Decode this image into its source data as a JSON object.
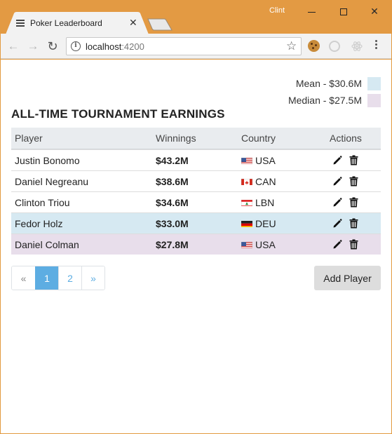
{
  "window": {
    "user": "Clint",
    "tab_title": "Poker Leaderboard"
  },
  "browser": {
    "url_host": "localhost",
    "url_port": ":4200"
  },
  "legend": {
    "mean_label": "Mean - $30.6M",
    "median_label": "Median - $27.5M",
    "mean_color": "#D6E9F2",
    "median_color": "#E8DEEB"
  },
  "page": {
    "heading": "ALL-TIME TOURNAMENT EARNINGS"
  },
  "table": {
    "columns": [
      "Player",
      "Winnings",
      "Country",
      "Actions"
    ],
    "rows": [
      {
        "player": "Justin Bonomo",
        "winnings": "$43.2M",
        "country": "USA",
        "flag": "usa",
        "highlight": ""
      },
      {
        "player": "Daniel Negreanu",
        "winnings": "$38.6M",
        "country": "CAN",
        "flag": "can",
        "highlight": ""
      },
      {
        "player": "Clinton Triou",
        "winnings": "$34.6M",
        "country": "LBN",
        "flag": "lbn",
        "highlight": ""
      },
      {
        "player": "Fedor Holz",
        "winnings": "$33.0M",
        "country": "DEU",
        "flag": "deu",
        "highlight": "mean"
      },
      {
        "player": "Daniel Colman",
        "winnings": "$27.8M",
        "country": "USA",
        "flag": "usa",
        "highlight": "median"
      }
    ]
  },
  "pagination": {
    "prev": "«",
    "pages": [
      "1",
      "2"
    ],
    "active_page": "1",
    "next": "»"
  },
  "actions": {
    "add_player_label": "Add Player"
  }
}
